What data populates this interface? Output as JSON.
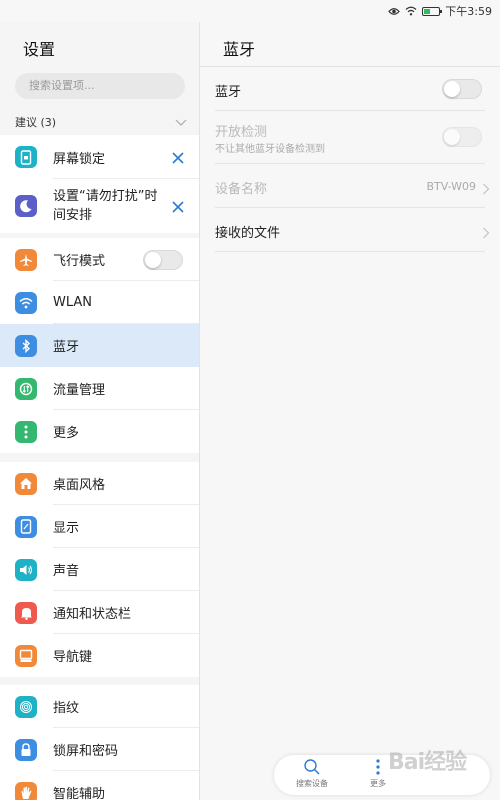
{
  "status_bar": {
    "time": "下午3:59"
  },
  "left": {
    "title": "设置",
    "search_placeholder": "搜索设置项...",
    "suggestions_header": "建议 (3)",
    "suggestions": [
      {
        "label": "屏幕锁定",
        "icon": "phone-lock-icon"
      },
      {
        "label_line1": "设置“请勿打扰”时",
        "label_line2": "间安排",
        "icon": "moon-icon"
      }
    ],
    "group1": [
      {
        "label": "飞行模式",
        "icon": "airplane-icon",
        "toggle": false
      },
      {
        "label": "WLAN",
        "icon": "wifi-icon"
      },
      {
        "label": "蓝牙",
        "icon": "bluetooth-icon",
        "selected": true
      },
      {
        "label": "流量管理",
        "icon": "data-usage-icon"
      },
      {
        "label": "更多",
        "icon": "more-vertical-icon"
      }
    ],
    "group2": [
      {
        "label": "桌面风格",
        "icon": "home-icon"
      },
      {
        "label": "显示",
        "icon": "display-icon"
      },
      {
        "label": "声音",
        "icon": "sound-icon"
      },
      {
        "label": "通知和状态栏",
        "icon": "bell-icon"
      },
      {
        "label": "导航键",
        "icon": "navigation-key-icon"
      }
    ],
    "group3": [
      {
        "label": "指纹",
        "icon": "fingerprint-icon"
      },
      {
        "label": "锁屏和密码",
        "icon": "padlock-icon"
      },
      {
        "label": "智能辅助",
        "icon": "hand-icon"
      }
    ]
  },
  "right": {
    "title": "蓝牙",
    "rows": {
      "bluetooth": {
        "label": "蓝牙",
        "toggle": false
      },
      "discoverable": {
        "label": "开放检测",
        "sub": "不让其他蓝牙设备检测到",
        "toggle": false,
        "disabled": true
      },
      "device_name": {
        "label": "设备名称",
        "value": "BTV-W09",
        "disabled": true
      },
      "received_files": {
        "label": "接收的文件"
      }
    }
  },
  "bottom_bar": {
    "search_label": "搜索设备",
    "more_label": "更多"
  },
  "watermark": "Bai经验",
  "colors": {
    "selected_bg": "#dbe9f9",
    "accent_blue": "#2b7bd6",
    "orange": "#f08a3a",
    "green": "#34b870",
    "red": "#ef5a4f",
    "purple": "#5b5fc7",
    "teal": "#1fb2c6"
  }
}
